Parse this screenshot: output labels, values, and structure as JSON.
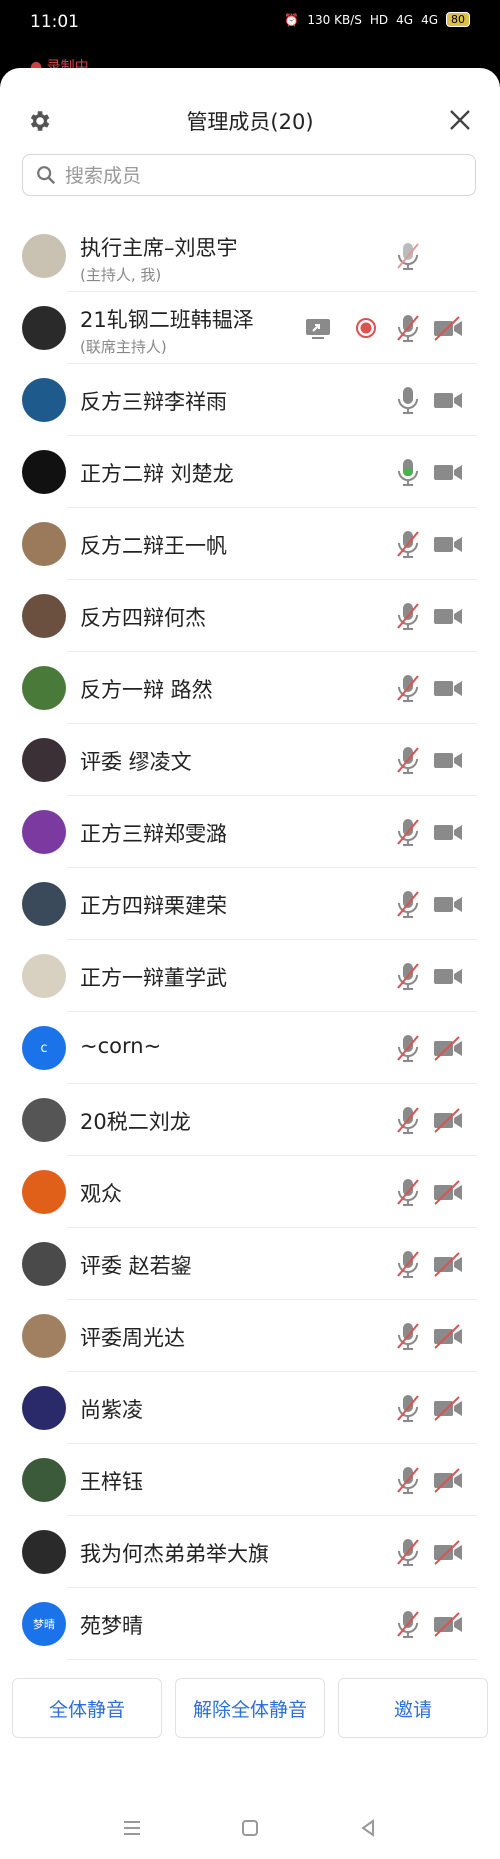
{
  "status_bar": {
    "time": "11:01",
    "net_speed": "130 KB/S",
    "hd": "HD",
    "signal1": "4G",
    "signal2": "4G",
    "battery": "80"
  },
  "recording_label": "录制中",
  "header": {
    "title": "管理成员(20)"
  },
  "search": {
    "placeholder": "搜索成员"
  },
  "members": [
    {
      "name": "执行主席–刘思宇",
      "role": "(主持人, 我)",
      "avatar_color": "#c9c2b3",
      "mic": "muted-light",
      "cam": "none"
    },
    {
      "name": "21轧钢二班韩韫泽",
      "role": "(联席主持人)",
      "avatar_color": "#2a2a2a",
      "mic": "muted",
      "cam": "off",
      "share": true,
      "recording": true
    },
    {
      "name": "反方三辩李祥雨",
      "role": "",
      "avatar_color": "#1e5a8c",
      "mic": "on",
      "cam": "on"
    },
    {
      "name": "正方二辩 刘楚龙",
      "role": "",
      "avatar_color": "#111111",
      "mic": "active",
      "cam": "on"
    },
    {
      "name": "反方二辩王一帆",
      "role": "",
      "avatar_color": "#9a7a5a",
      "mic": "muted",
      "cam": "on"
    },
    {
      "name": "反方四辩何杰",
      "role": "",
      "avatar_color": "#6b5040",
      "mic": "muted",
      "cam": "on"
    },
    {
      "name": "反方一辩 路然",
      "role": "",
      "avatar_color": "#4a7a3a",
      "mic": "muted",
      "cam": "on"
    },
    {
      "name": "评委 缪凌文",
      "role": "",
      "avatar_color": "#3a3035",
      "mic": "muted",
      "cam": "on"
    },
    {
      "name": "正方三辩郑雯潞",
      "role": "",
      "avatar_color": "#7a3aa0",
      "mic": "muted",
      "cam": "on"
    },
    {
      "name": "正方四辩栗建荣",
      "role": "",
      "avatar_color": "#3a4a5a",
      "mic": "muted",
      "cam": "on"
    },
    {
      "name": "正方一辩董学武",
      "role": "",
      "avatar_color": "#d8d0c0",
      "mic": "muted",
      "cam": "on"
    },
    {
      "name": "~corn~",
      "role": "",
      "avatar_color": "#1a73e8",
      "avatar_text": "c",
      "mic": "muted",
      "cam": "off"
    },
    {
      "name": "20税二刘龙",
      "role": "",
      "avatar_color": "#555555",
      "mic": "muted",
      "cam": "off"
    },
    {
      "name": "观众",
      "role": "",
      "avatar_color": "#e0601a",
      "mic": "muted",
      "cam": "off"
    },
    {
      "name": "评委 赵若鋆",
      "role": "",
      "avatar_color": "#4a4a4a",
      "mic": "muted",
      "cam": "off"
    },
    {
      "name": "评委周光达",
      "role": "",
      "avatar_color": "#a08060",
      "mic": "muted",
      "cam": "off"
    },
    {
      "name": "尚紫凌",
      "role": "",
      "avatar_color": "#2a2a6a",
      "mic": "muted",
      "cam": "off"
    },
    {
      "name": "王梓钰",
      "role": "",
      "avatar_color": "#3a5a3a",
      "mic": "muted",
      "cam": "off"
    },
    {
      "name": "我为何杰弟弟举大旗",
      "role": "",
      "avatar_color": "#2a2a2a",
      "mic": "muted",
      "cam": "off"
    },
    {
      "name": "苑梦晴",
      "role": "",
      "avatar_color": "#1a73e8",
      "avatar_text": "梦晴",
      "mic": "muted",
      "cam": "off"
    }
  ],
  "footer": {
    "mute_all": "全体静音",
    "unmute_all": "解除全体静音",
    "invite": "邀请"
  },
  "colors": {
    "accent": "#2f6fd6",
    "muted_red": "#d9534f",
    "active_green": "#4caf50",
    "icon_gray": "#8a8a8a"
  }
}
